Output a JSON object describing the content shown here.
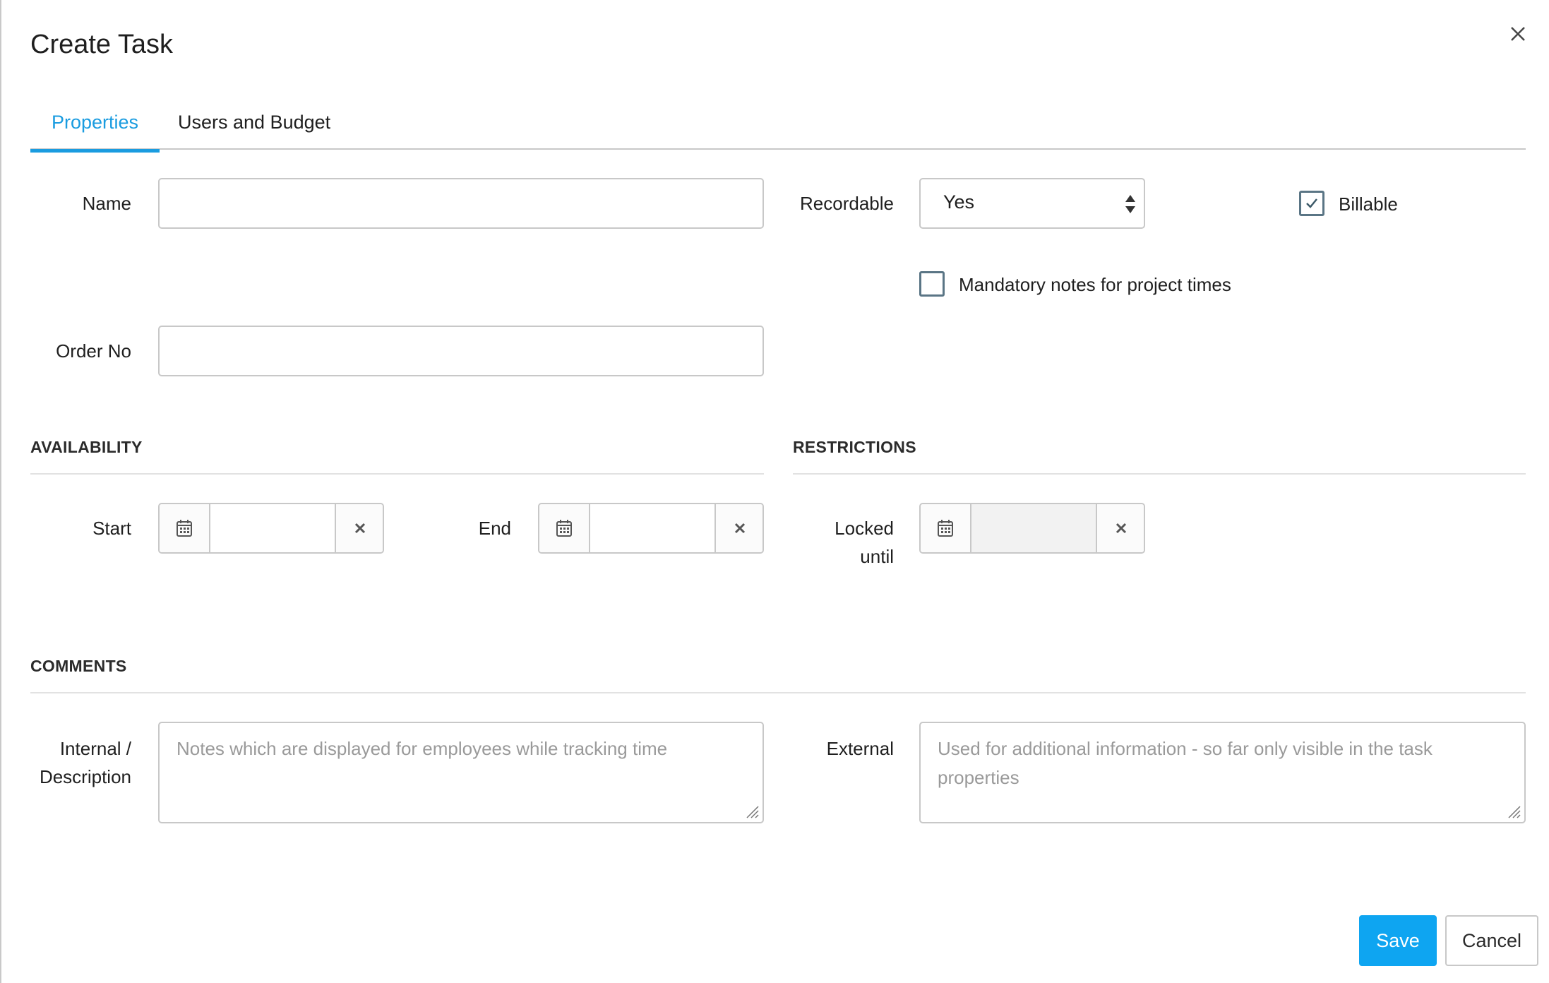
{
  "dialog": {
    "title": "Create Task"
  },
  "tabs": [
    {
      "label": "Properties",
      "active": true
    },
    {
      "label": "Users and Budget",
      "active": false
    }
  ],
  "properties": {
    "name_label": "Name",
    "name_value": "",
    "order_no_label": "Order No",
    "order_no_value": "",
    "recordable_label": "Recordable",
    "recordable_value": "Yes",
    "billable_label": "Billable",
    "billable_checked": true,
    "mandatory_notes_label": "Mandatory notes for project times",
    "mandatory_notes_checked": false
  },
  "availability": {
    "heading": "AVAILABILITY",
    "start_label": "Start",
    "start_value": "",
    "end_label": "End",
    "end_value": ""
  },
  "restrictions": {
    "heading": "RESTRICTIONS",
    "locked_until_label_line1": "Locked",
    "locked_until_label_line2": "until",
    "locked_until_value": ""
  },
  "comments": {
    "heading": "COMMENTS",
    "internal_label_line1": "Internal /",
    "internal_label_line2": "Description",
    "internal_placeholder": "Notes which are displayed for employees while tracking time",
    "external_label": "External",
    "external_placeholder_line1": "Used for additional information - so far only visible in the task",
    "external_placeholder_line2": "properties"
  },
  "footer": {
    "save_label": "Save",
    "cancel_label": "Cancel"
  },
  "colors": {
    "accent": "#1a9ce0",
    "primary_button": "#0ea5f1",
    "checkbox_border": "#5a7585"
  },
  "icons": [
    "close-icon",
    "calendar-icon",
    "clear-icon",
    "select-arrows-icon",
    "check-icon",
    "resize-handle-icon"
  ]
}
